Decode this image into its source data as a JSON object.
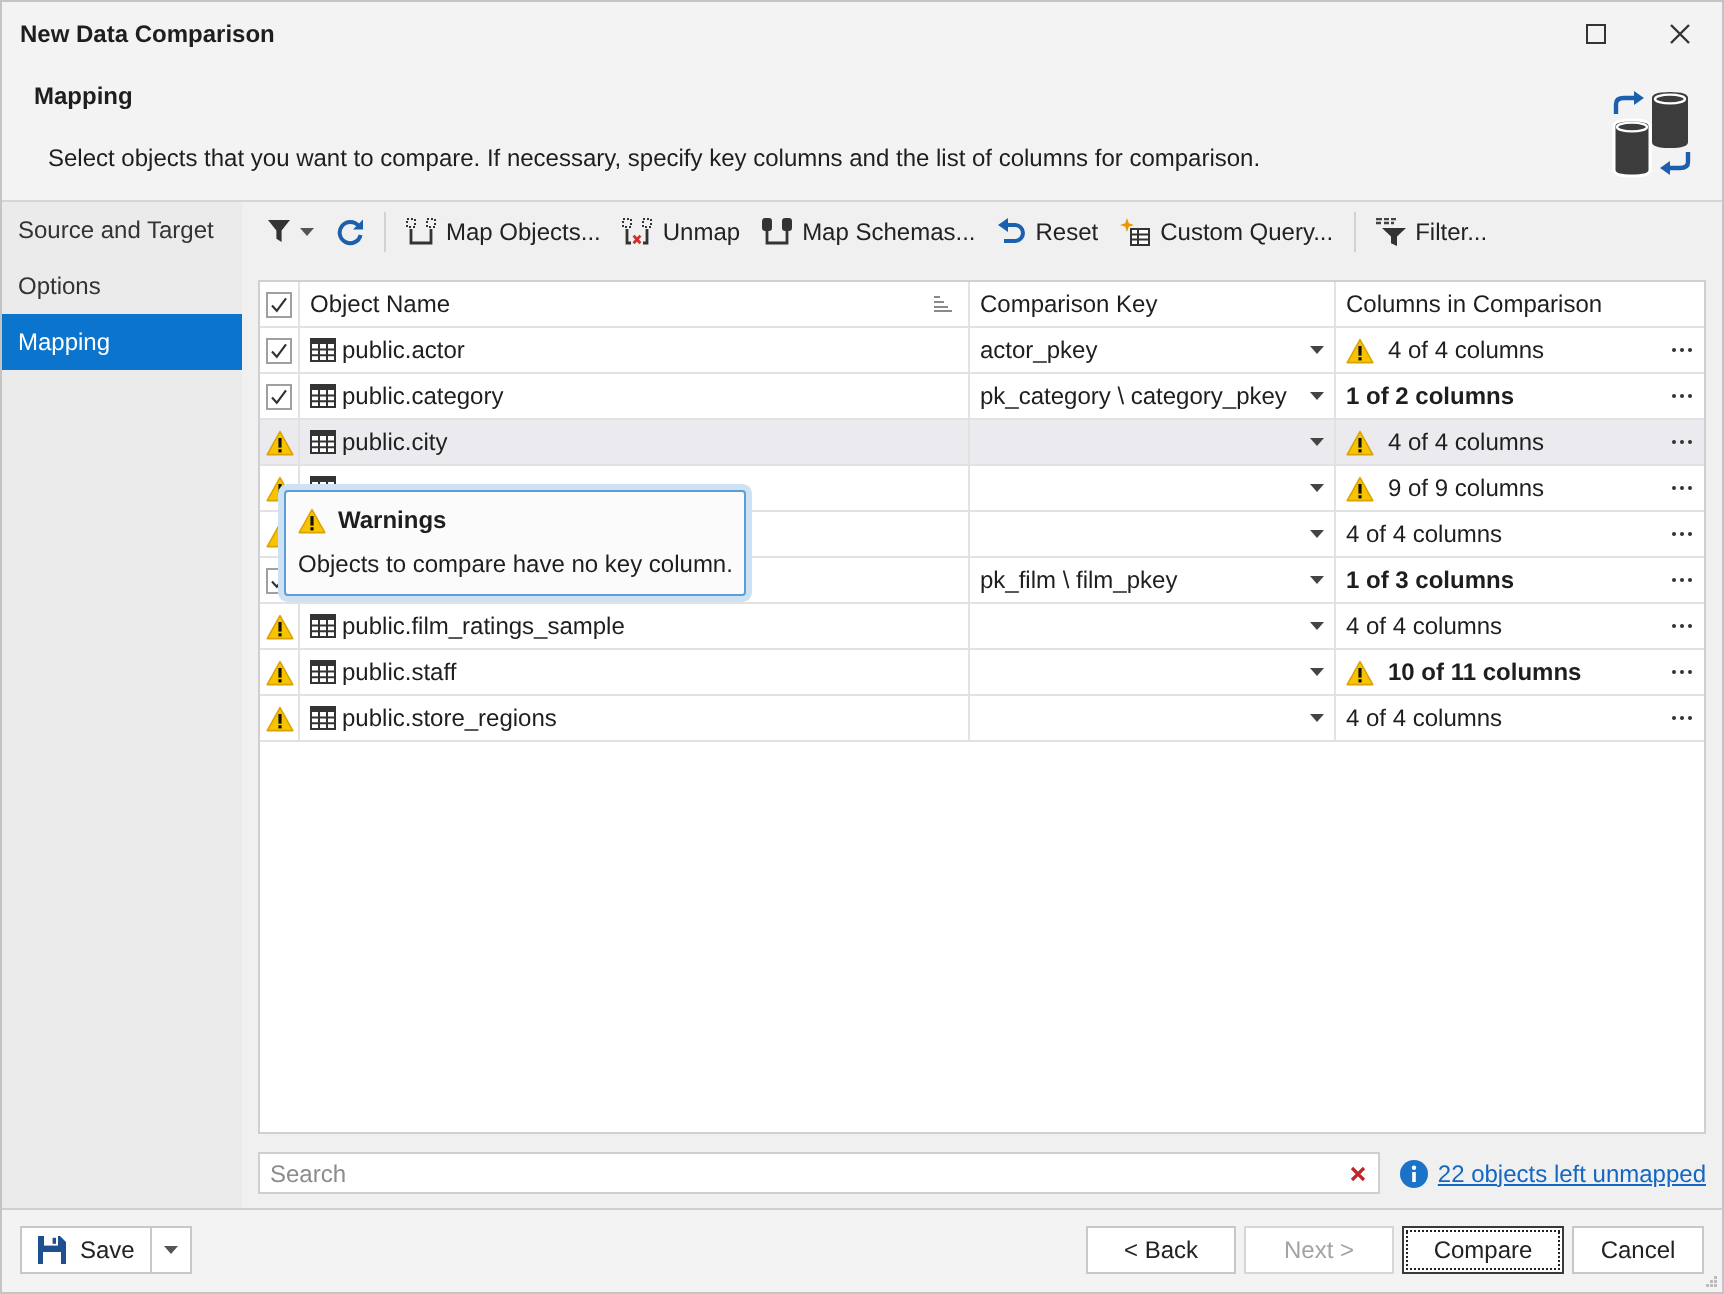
{
  "window": {
    "title": "New Data Comparison"
  },
  "header": {
    "title": "Mapping",
    "description": "Select objects that you want to compare. If necessary, specify key columns and the list of columns for comparison."
  },
  "sidebar": {
    "items": [
      {
        "label": "Source and Target",
        "selected": false
      },
      {
        "label": "Options",
        "selected": false
      },
      {
        "label": "Mapping",
        "selected": true
      }
    ]
  },
  "toolbar": {
    "items": [
      {
        "kind": "filter"
      },
      {
        "kind": "refresh"
      },
      {
        "kind": "separator"
      },
      {
        "kind": "map",
        "label": "Map Objects..."
      },
      {
        "kind": "unmap",
        "label": "Unmap"
      },
      {
        "kind": "map_schemas",
        "label": "Map Schemas..."
      },
      {
        "kind": "reset",
        "label": "Reset"
      },
      {
        "kind": "custom_query",
        "label": "Custom Query..."
      },
      {
        "kind": "separator"
      },
      {
        "kind": "sql_filter",
        "label": "Filter..."
      }
    ]
  },
  "grid": {
    "all_checked": true,
    "columns": [
      "Object Name",
      "Comparison Key",
      "Columns in Comparison"
    ],
    "rows": [
      {
        "kind": "checkbox",
        "checked": true,
        "name": "public.actor",
        "key": "actor_pkey",
        "columns": "4 of 4 columns",
        "columns_warning": true,
        "partial": false,
        "selected": false
      },
      {
        "kind": "checkbox",
        "checked": true,
        "name": "public.category",
        "key": "pk_category \\ category_pkey",
        "columns": "1 of 2 columns",
        "columns_warning": false,
        "partial": true,
        "selected": false
      },
      {
        "kind": "warning",
        "name": "public.city",
        "columns": "4 of 4 columns",
        "columns_warning": true,
        "partial": false,
        "selected": true
      },
      {
        "kind": "warning",
        "columns": "9 of 9 columns",
        "columns_warning": true,
        "partial": false,
        "selected": false
      },
      {
        "kind": "warning",
        "columns": "4 of 4 columns",
        "columns_warning": false,
        "partial": false,
        "selected": false
      },
      {
        "kind": "checkbox",
        "checked": true,
        "key": "pk_film \\ film_pkey",
        "columns": "1 of 3 columns",
        "columns_warning": false,
        "partial": true,
        "selected": false
      },
      {
        "kind": "warning",
        "name": "public.film_ratings_sample",
        "columns": "4 of 4 columns",
        "columns_warning": false,
        "partial": false,
        "selected": false
      },
      {
        "kind": "warning",
        "name": "public.staff",
        "columns": "10 of 11 columns",
        "columns_warning": true,
        "partial": true,
        "selected": false
      },
      {
        "kind": "warning",
        "name": "public.store_regions",
        "columns": "4 of 4 columns",
        "columns_warning": false,
        "partial": false,
        "selected": false
      }
    ]
  },
  "tooltip": {
    "title": "Warnings",
    "text": "Objects to compare have no key column."
  },
  "search": {
    "placeholder": "Search"
  },
  "unmapped_link": "22 objects left unmapped",
  "footer": {
    "save": "Save",
    "buttons": [
      {
        "label": "< Back",
        "disabled": false,
        "focused": false
      },
      {
        "label": "Next >",
        "disabled": true,
        "focused": false
      },
      {
        "label": "Compare",
        "disabled": false,
        "focused": true
      },
      {
        "label": "Cancel",
        "disabled": false,
        "focused": false
      }
    ]
  }
}
